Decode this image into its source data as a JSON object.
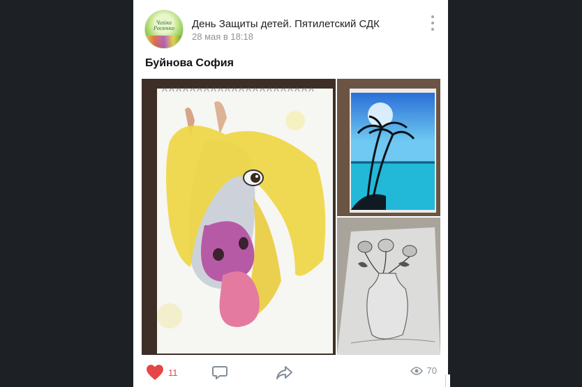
{
  "post": {
    "group_name": "День Защиты детей. Пятилетский СДК",
    "date": "28 мая в 18:18",
    "text": "Буйнова София",
    "avatar_text": "Чайка Росенко",
    "icons": {
      "more": "more-vertical-icon",
      "like": "heart-icon",
      "comment": "comment-icon",
      "share": "share-arrow-icon",
      "views": "eye-icon"
    },
    "photos": [
      "horse-painting",
      "palm-sunset-painting",
      "rose-vase-drawing"
    ]
  },
  "actions": {
    "likes": "11",
    "views": "70"
  },
  "colors": {
    "accent": "#e64646",
    "muted": "#8a9299",
    "background": "#1d2025"
  }
}
